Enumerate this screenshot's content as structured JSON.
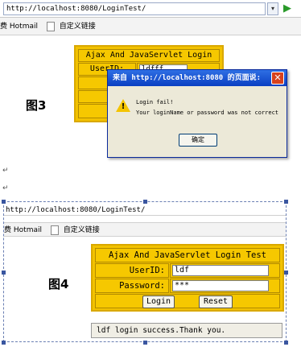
{
  "shot1": {
    "url": "http://localhost:8080/LoginTest/",
    "dropdown_glyph": "▾",
    "go_glyph": "▶",
    "links_prefix": "费",
    "link_hotmail": "Hotmail",
    "link_custom": "自定义链接",
    "table_title": "Ajax And JavaServlet Login Test",
    "userid_label": "UserID:",
    "userid_value": "ldfff",
    "password_label_partial": "Pass",
    "figure_label": "图3",
    "dialog": {
      "title": "来自 http://localhost:8080 的页面说:",
      "close_glyph": "✕",
      "warn_glyph": "!",
      "line1": "Login fail!",
      "line2": "Your loginName or password was not correct",
      "ok_label": "确定"
    }
  },
  "return_glyph": "↵",
  "shot2": {
    "url": "http://localhost:8080/LoginTest/",
    "links_prefix": "费",
    "link_hotmail": "Hotmail",
    "link_custom": "自定义链接",
    "table_title": "Ajax And JavaServlet Login Test",
    "userid_label": "UserID:",
    "userid_value": "ldf",
    "password_label": "Password:",
    "password_value": "***",
    "login_label": "Login",
    "reset_label": "Reset",
    "figure_label": "图4",
    "result_text": "ldf login success.Thank you."
  },
  "colors": {
    "table_yellow": "#f6c800",
    "dialog_title_blue": "#0a3fc2",
    "selection_blue": "#3a56a0"
  }
}
